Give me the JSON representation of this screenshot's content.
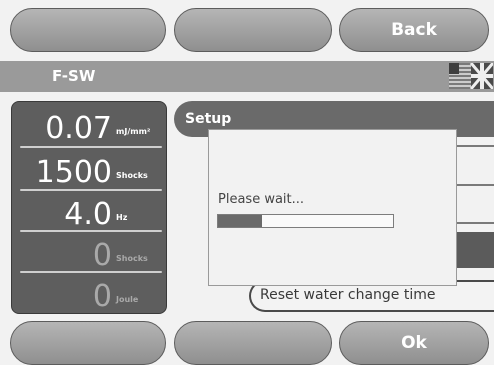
{
  "top_buttons": [
    "",
    "",
    "Back"
  ],
  "title": "F-SW",
  "readouts": [
    {
      "value": "0.07",
      "unit": "mJ/mm²"
    },
    {
      "value": "1500",
      "unit": "Shocks"
    },
    {
      "value": "4.0",
      "unit": "Hz"
    },
    {
      "value": "0",
      "unit": "Shocks"
    },
    {
      "value": "0",
      "unit": "Joule"
    }
  ],
  "setup_label": "Setup",
  "dialog": {
    "message": "Please wait...",
    "progress_fraction": 0.25
  },
  "reset_label": "Reset water change time",
  "bottom_buttons": [
    "",
    "",
    "Ok"
  ],
  "colors": {
    "panel": "#5e5e5e",
    "button": "#a3a3a3",
    "titlebar": "#9a9a9a"
  }
}
